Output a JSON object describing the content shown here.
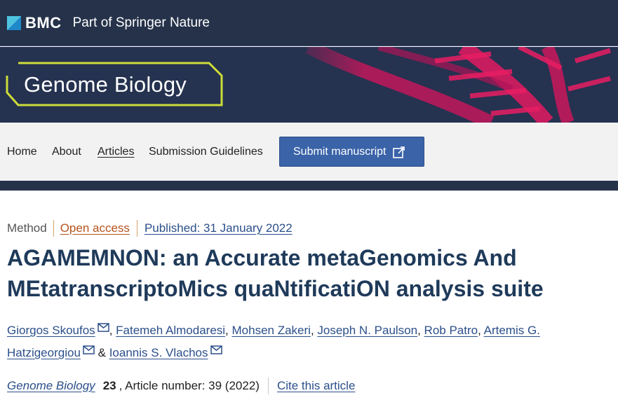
{
  "header": {
    "brand": "BMC",
    "brand_sub": "Part of Springer Nature"
  },
  "journal": {
    "title": "Genome Biology"
  },
  "nav": {
    "items": [
      {
        "label": "Home"
      },
      {
        "label": "About"
      },
      {
        "label": "Articles"
      },
      {
        "label": "Submission Guidelines"
      }
    ],
    "submit_label": "Submit manuscript"
  },
  "article": {
    "type": "Method",
    "access": "Open access",
    "published": "Published: 31 January 2022",
    "title": "AGAMEMNON: an Accurate metaGenomics And MEtatranscriptoMics quaNtificatiON analysis suite",
    "authors": [
      {
        "name": "Giorgos Skoufos",
        "sep": ", "
      },
      {
        "name": "Fatemeh Almodaresi",
        "sep": ", "
      },
      {
        "name": "Mohsen Zakeri",
        "sep": ", "
      },
      {
        "name": "Joseph N. Paulson",
        "sep": ", "
      },
      {
        "name": "Rob Patro",
        "sep": ", "
      },
      {
        "name": "Artemis G. Hatzigeorgiou",
        "sep": " & "
      },
      {
        "name": "Ioannis S. Vlachos",
        "sep": ""
      }
    ]
  },
  "citation": {
    "journal": "Genome Biology",
    "volume": "23",
    "details": ", Article number: 39 (2022)",
    "cite_link": "Cite this article"
  },
  "colors": {
    "brand_navy": "#25324a",
    "accent_lime": "#cddc39",
    "button_blue": "#3a63a8",
    "link_blue": "#2b4f8a",
    "open_access_orange": "#b5541e"
  }
}
